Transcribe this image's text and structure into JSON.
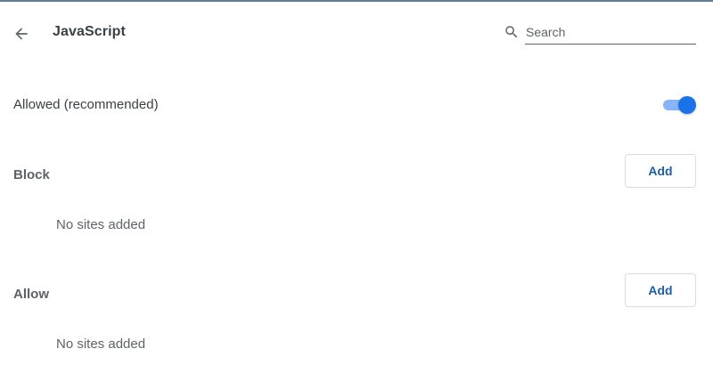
{
  "header": {
    "title": "JavaScript",
    "search_placeholder": "Search",
    "search_value": ""
  },
  "allowed": {
    "label": "Allowed (recommended)",
    "enabled": true
  },
  "block_section": {
    "title": "Block",
    "add_label": "Add",
    "empty_text": "No sites added"
  },
  "allow_section": {
    "title": "Allow",
    "add_label": "Add",
    "empty_text": "No sites added"
  },
  "icons": {
    "back": "arrow-back-icon",
    "search": "search-icon"
  },
  "colors": {
    "accent": "#1a73e8",
    "toggle_track": "#8ab4f8",
    "button_text": "#1a5fa8"
  }
}
